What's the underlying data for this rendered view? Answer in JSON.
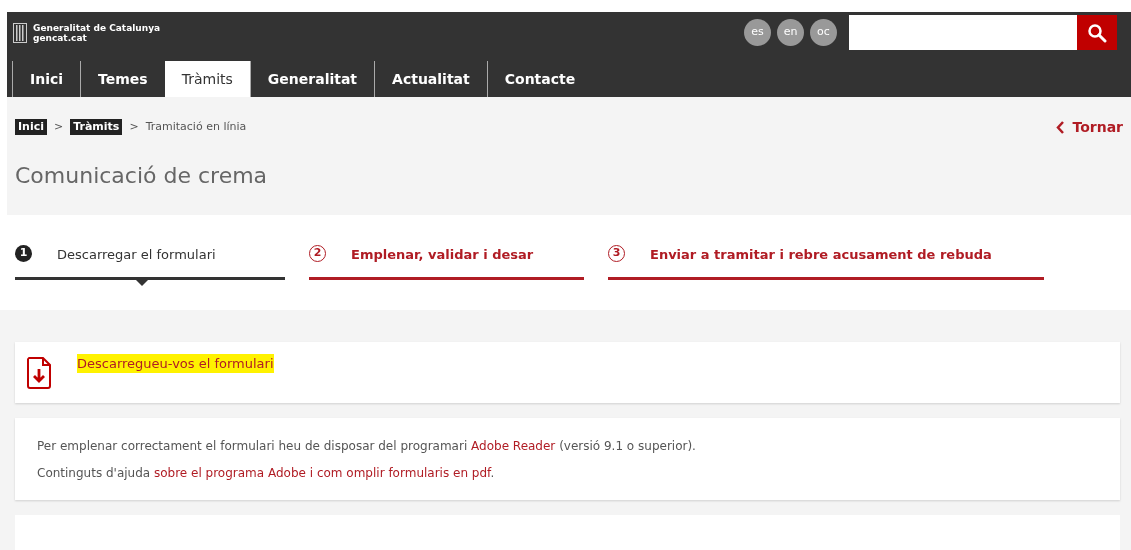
{
  "header": {
    "logo_text": [
      "Generalitat de Catalunya",
      "gencat.cat"
    ],
    "languages": [
      "es",
      "en",
      "oc"
    ]
  },
  "nav": [
    {
      "label": "Inici",
      "selected": false
    },
    {
      "label": "Temes",
      "selected": false
    },
    {
      "label": "Tràmits",
      "selected": true
    },
    {
      "label": "Generalitat",
      "selected": false
    },
    {
      "label": "Actualitat",
      "selected": false
    },
    {
      "label": "Contacte",
      "selected": false
    }
  ],
  "breadcrumb": [
    {
      "label": "Inici",
      "kind": "link"
    },
    {
      "label": "Tràmits",
      "kind": "link"
    },
    {
      "label": "Tramitació en línia",
      "kind": "current"
    }
  ],
  "separator": ">",
  "back_link": "Tornar",
  "title": "Comunicació de crema",
  "steps": [
    {
      "number": "1",
      "label": "Descarregar el formulari",
      "selected": true
    },
    {
      "number": "2",
      "label": "Emplenar, validar i desar",
      "selected": false
    },
    {
      "number": "3",
      "label": "Enviar a tramitar i rebre acusament de rebuda",
      "selected": false
    }
  ],
  "download": {
    "label": "Descarregueu-vos el formulari",
    "highlighted": true
  },
  "info": [
    [
      {
        "kind": "text",
        "text": "Per emplenar correctament el formulari heu de disposar del programari "
      },
      {
        "kind": "link",
        "text": "Adobe Reader"
      },
      {
        "kind": "text",
        "text": " (versió 9.1 o superior)."
      }
    ],
    [
      {
        "kind": "text",
        "text": "Continguts d'ajuda "
      },
      {
        "kind": "link",
        "text": "sobre el programa Adobe i com omplir formularis en pdf"
      },
      {
        "kind": "text",
        "text": "."
      }
    ]
  ]
}
